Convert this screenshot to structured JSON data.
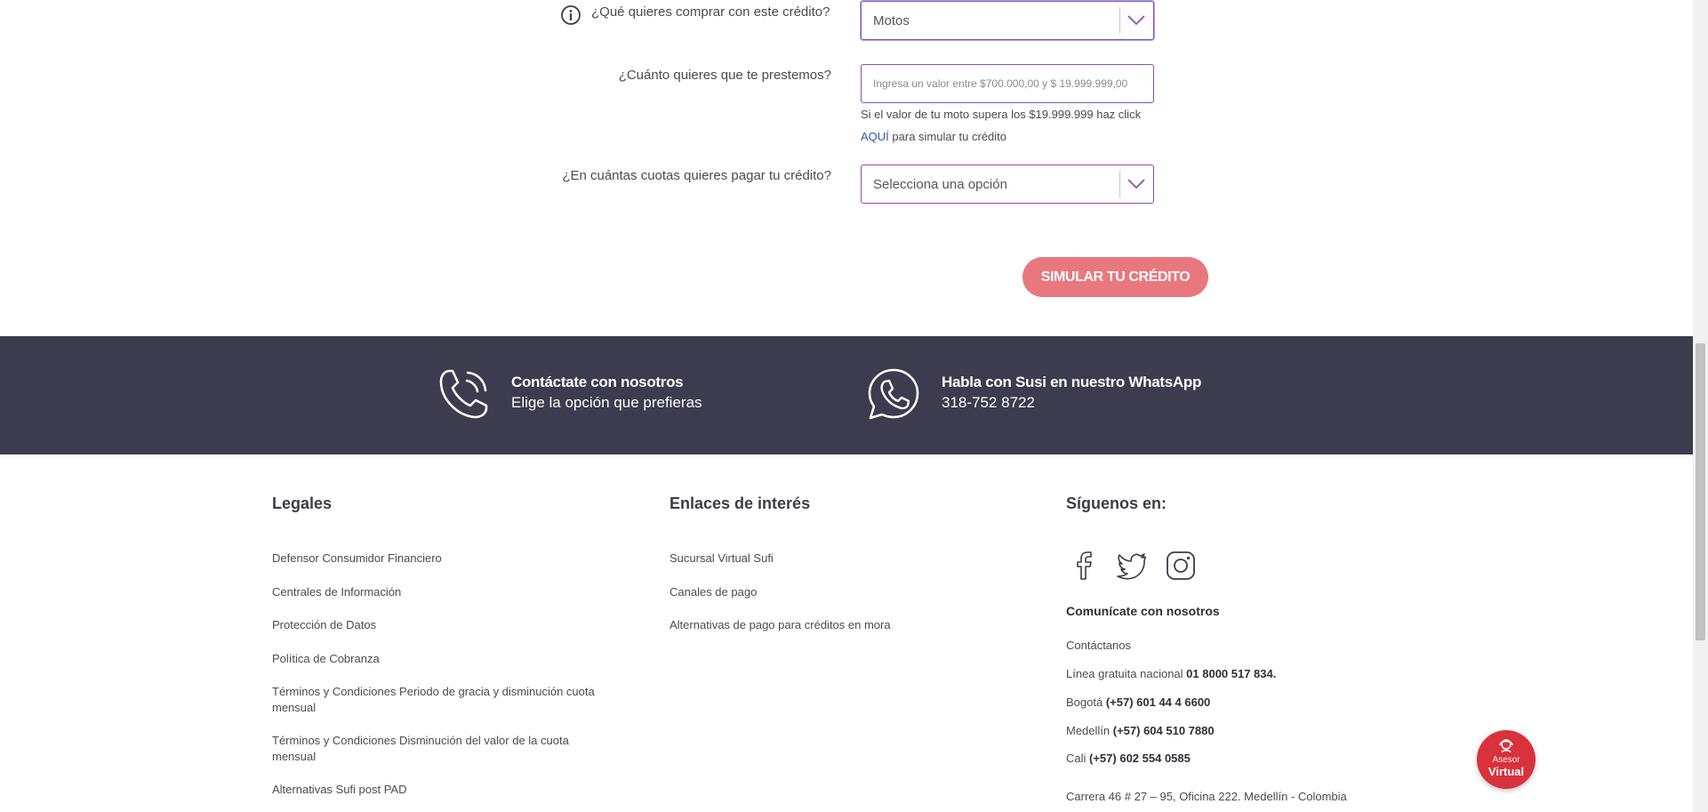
{
  "form": {
    "purchase_label": "¿Qué quieres comprar con este crédito?",
    "purchase_value": "Motos",
    "amount_label": "¿Cuánto quieres que te prestemos?",
    "amount_placeholder": "Ingresa un valor entre $700.000,00 y $ 19.999.999,00",
    "amount_hint_line1": "Si el valor de tu moto supera los $19.999.999 haz click",
    "amount_hint_link": "AQUÍ",
    "amount_hint_line2": " para simular tu crédito",
    "installments_label": "¿En cuántas cuotas quieres pagar tu crédito?",
    "installments_value": "Selecciona una opción",
    "submit_label": "SIMULAR TU CRÉDITO"
  },
  "contact_band": {
    "phone_title": "Contáctate con nosotros",
    "phone_sub": "Elige la opción que prefieras",
    "whatsapp_title": "Habla con Susi en nuestro WhatsApp",
    "whatsapp_number": "318-752 8722",
    "phone_icon": "phone-icon",
    "whatsapp_icon": "whatsapp-icon"
  },
  "footer": {
    "legales": {
      "title": "Legales",
      "links": [
        "Defensor Consumidor Financiero",
        "Centrales de Información",
        "Protección de Datos",
        "Política de Cobranza",
        "Términos y Condiciones Periodo de gracia y disminución cuota mensual",
        "Términos y Condiciones Disminución del valor de la cuota mensual",
        "Alternativas Sufi post PAD"
      ]
    },
    "enlaces": {
      "title": "Enlaces de interés",
      "links": [
        "Sucursal Virtual Sufi",
        "Canales de pago",
        "Alternativas de pago para créditos en mora"
      ]
    },
    "siguenos": {
      "title": "Síguenos en:",
      "icons": [
        "facebook-icon",
        "twitter-icon",
        "instagram-icon"
      ],
      "comunicate_title": "Comunícate con nosotros",
      "contactanos": "Contáctanos",
      "linea_label": "Línea gratuita nacional ",
      "linea_number": "01 8000 517 834.",
      "bogota_label": "Bogotá ",
      "bogota_number": "(+57) 601 44 4 6600",
      "medellin_label": "Medellín ",
      "medellin_number": "(+57) 604 510 7880",
      "cali_label": "Cali ",
      "cali_number": "(+57) 602 554 0585",
      "address": "Carrera 46 # 27 – 95, Oficina 222. Medellín - Colombia"
    }
  },
  "bot": {
    "line1": "Asesor",
    "line2": "Virtual"
  },
  "colors": {
    "accent_purple": "#8e4fa0",
    "button_pink": "#e8787e",
    "band_dark": "#3d3b4e",
    "bot_red": "#d8323c",
    "link_blue": "#2d5aa8"
  }
}
